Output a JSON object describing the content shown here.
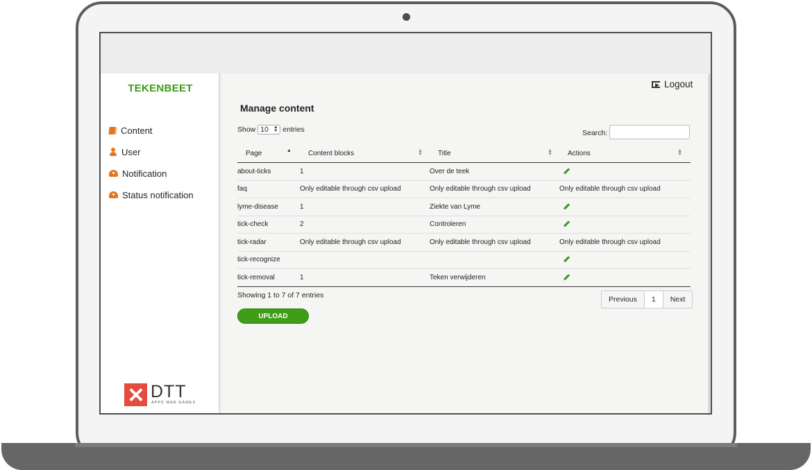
{
  "sidebar": {
    "brand": "TEKENBEET",
    "items": [
      {
        "label": "Content",
        "icon": "book-icon"
      },
      {
        "label": "User",
        "icon": "user-icon"
      },
      {
        "label": "Notification",
        "icon": "gauge-icon"
      },
      {
        "label": "Status notification",
        "icon": "gauge-icon"
      }
    ],
    "logo": {
      "text": "DTT",
      "subtext": "APPS WEB GAMES"
    }
  },
  "header": {
    "logout_label": "Logout"
  },
  "main": {
    "title": "Manage content",
    "show_label": "Show",
    "entries_value": "10",
    "entries_label": "entries",
    "search_label": "Search:",
    "search_value": ""
  },
  "table": {
    "columns": [
      "Page",
      "Content blocks",
      "Title",
      "Actions"
    ],
    "rows": [
      {
        "page": "about-ticks",
        "blocks": "1",
        "title": "Over de teek",
        "action": ""
      },
      {
        "page": "faq",
        "blocks": "Only editable through csv upload",
        "title": "Only editable through csv upload",
        "action": "Only editable through csv upload"
      },
      {
        "page": "lyme-disease",
        "blocks": "1",
        "title": "Ziekte van Lyme",
        "action": ""
      },
      {
        "page": "tick-check",
        "blocks": "2",
        "title": "Controleren",
        "action": ""
      },
      {
        "page": "tick-radar",
        "blocks": "Only editable through csv upload",
        "title": "Only editable through csv upload",
        "action": "Only editable through csv upload"
      },
      {
        "page": "tick-recognize",
        "blocks": "",
        "title": "",
        "action": ""
      },
      {
        "page": "tick-removal",
        "blocks": "1",
        "title": "Teken verwijderen",
        "action": ""
      }
    ]
  },
  "footer": {
    "showing_text": "Showing 1 to 7 of 7 entries",
    "previous_label": "Previous",
    "page_number": "1",
    "next_label": "Next",
    "upload_label": "UPLOAD"
  },
  "colors": {
    "brand_green": "#3d9a14",
    "icon_orange": "#e5761f",
    "logo_red": "#e34d3f"
  }
}
